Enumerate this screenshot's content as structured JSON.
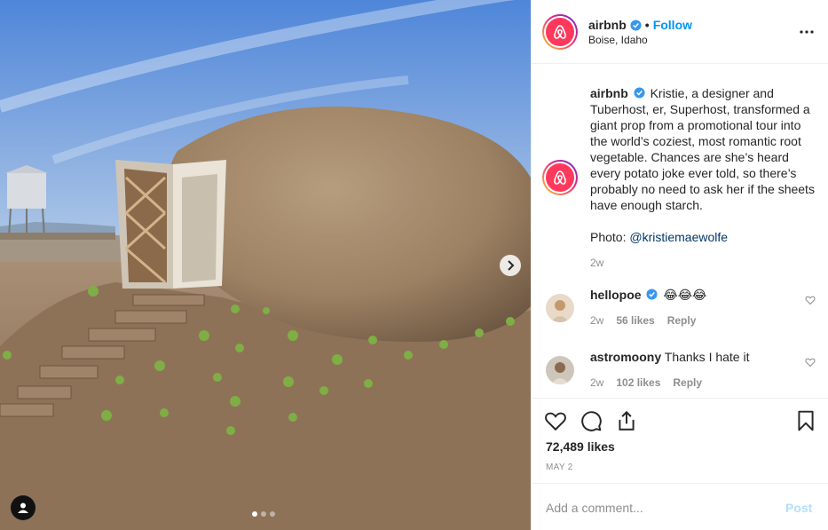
{
  "post": {
    "photo_alt": "Giant potato house with a wooden door on a dirt mound",
    "carousel": {
      "count": 3,
      "active": 1
    },
    "icons": {
      "next": "chevron-right-icon",
      "tag": "user-tag-icon"
    }
  },
  "header": {
    "username": "airbnb",
    "bullet": "•",
    "follow_label": "Follow",
    "location": "Boise, Idaho",
    "more_icon": "more-horizontal-icon"
  },
  "caption": {
    "username": "airbnb",
    "text": "Kristie, a designer and Tuberhost, er, Superhost, transformed a giant prop from a promotional tour into the world’s coziest, most romantic root vegetable. Chances are she’s heard every potato joke ever told, so there’s probably no need to ask her if the sheets have enough starch.",
    "photo_prefix": "Photo: ",
    "photo_credit": "@kristiemaewolfe",
    "time": "2w"
  },
  "comments": [
    {
      "username": "hellopoe",
      "text": "😂😂😂",
      "time": "2w",
      "likes": "56 likes",
      "reply": "Reply"
    },
    {
      "username": "astromoony",
      "text": "Thanks I hate it",
      "time": "2w",
      "likes": "102 likes",
      "reply": "Reply"
    }
  ],
  "actions": {
    "icons": [
      "heart-icon",
      "comment-icon",
      "share-icon",
      "bookmark-icon"
    ],
    "likes": "72,489 likes",
    "date": "MAY 2"
  },
  "composer": {
    "placeholder": "Add a comment...",
    "post_label": "Post"
  },
  "colors": {
    "brand": "#ff385c",
    "link": "#0095f6",
    "muted": "#8e8e8e",
    "post_disabled": "#b2dffc"
  }
}
